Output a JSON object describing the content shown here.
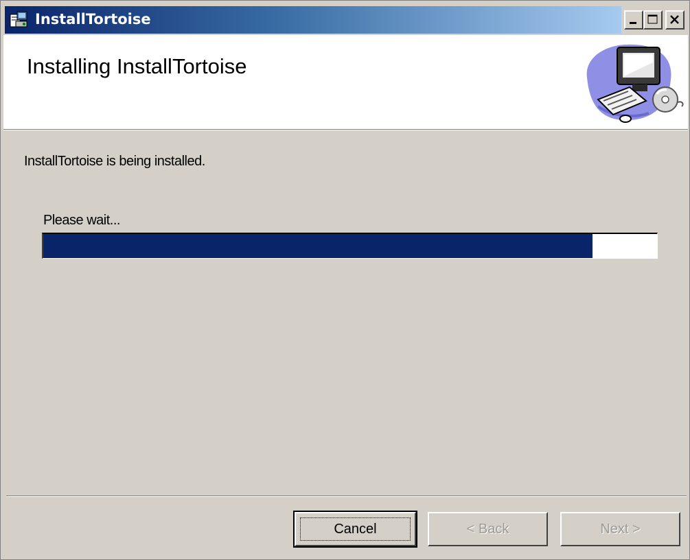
{
  "window": {
    "title": "InstallTortoise",
    "title_icon": "installer-icon",
    "caption_buttons": [
      "minimize-icon",
      "maximize-icon",
      "close-icon"
    ]
  },
  "banner": {
    "heading": "Installing InstallTortoise",
    "art": "computer-with-disc-illustration"
  },
  "body": {
    "status": "InstallTortoise is being installed.",
    "wait_label": "Please wait...",
    "progress_fraction": 0.895
  },
  "buttons": {
    "cancel": "Cancel",
    "back": "< Back",
    "next": "Next >"
  },
  "colors": {
    "titlebar_start": "#0a246a",
    "titlebar_end": "#a6caf0",
    "progress_fill": "#0a246a",
    "window_bg": "#d4d0c8"
  }
}
